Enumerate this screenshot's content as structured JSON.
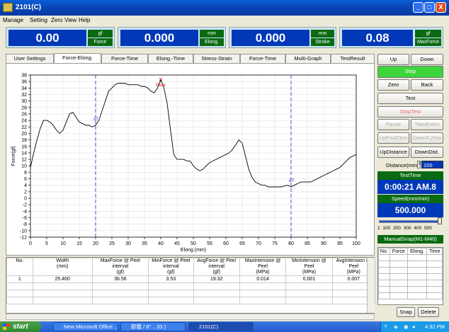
{
  "window": {
    "title": "2101(C)",
    "controls": [
      "_",
      "□",
      "X"
    ]
  },
  "menu": [
    "Manage",
    "Setting",
    "Zero",
    "View",
    "Help"
  ],
  "readouts": [
    {
      "value": "0.00",
      "unit": "gf",
      "name": "Force"
    },
    {
      "value": "0.000",
      "unit": "mm",
      "name": "Elong."
    },
    {
      "value": "0.000",
      "unit": "mm",
      "name": "Stroke"
    },
    {
      "value": "0.08",
      "unit": "gf",
      "name": "MaxForce"
    }
  ],
  "tabs": [
    "User Settings",
    "Force-Elong.",
    "Force-Time",
    "Elong.-Time",
    "Stress-Strain",
    "Force-Time",
    "Multi-Graph",
    "TestResult"
  ],
  "active_tab": 1,
  "chart_data": {
    "type": "line",
    "xlabel": "Elong.(mm)",
    "ylabel": "Force(gf)",
    "xlim": [
      0,
      100
    ],
    "ylim": [
      -12,
      38
    ],
    "xticks": [
      0,
      5,
      10,
      15,
      20,
      25,
      30,
      35,
      40,
      45,
      50,
      55,
      60,
      65,
      70,
      75,
      80,
      85,
      90,
      95,
      100
    ],
    "yticks": [
      -12,
      -10,
      -8,
      -6,
      -4,
      -2,
      0,
      2,
      4,
      6,
      8,
      10,
      12,
      14,
      16,
      18,
      20,
      22,
      24,
      26,
      28,
      30,
      32,
      34,
      36,
      38
    ],
    "grid": true,
    "markers": [
      {
        "label": "s7",
        "x": 20
      },
      {
        "label": "e7",
        "x": 80
      }
    ],
    "peak": {
      "label": "Peak",
      "x": 40,
      "y": 36.5
    },
    "x": [
      0,
      1,
      2,
      3,
      4,
      5,
      6,
      7,
      8,
      9,
      10,
      11,
      12,
      13,
      14,
      15,
      16,
      17,
      18,
      19,
      20,
      21,
      22,
      23,
      24,
      25,
      26,
      27,
      28,
      29,
      30,
      31,
      32,
      33,
      34,
      35,
      36,
      37,
      38,
      39,
      40,
      41,
      42,
      43,
      44,
      45,
      46,
      47,
      48,
      49,
      50,
      51,
      52,
      53,
      54,
      55,
      56,
      57,
      58,
      59,
      60,
      61,
      62,
      63,
      64,
      65,
      66,
      67,
      68,
      69,
      70,
      71,
      72,
      73,
      74,
      75,
      76,
      77,
      78,
      79,
      80,
      81,
      82,
      83,
      84,
      85,
      86,
      87,
      88,
      89,
      90,
      91,
      92,
      93,
      94,
      95,
      96,
      97,
      98,
      99,
      100
    ],
    "y": [
      9.5,
      14,
      18,
      21.5,
      24,
      24,
      23.5,
      22.5,
      21,
      20,
      21,
      23.5,
      26,
      26.5,
      25,
      23.5,
      23,
      22.5,
      22.5,
      22,
      22.5,
      24,
      27,
      30,
      33,
      34,
      35,
      35.5,
      35.5,
      35.5,
      35,
      35,
      35,
      35,
      34.5,
      34.5,
      34,
      33,
      32.5,
      34,
      36.5,
      34,
      29,
      21,
      13.5,
      12,
      12,
      12,
      11.5,
      11.5,
      10,
      9,
      8.5,
      9,
      10,
      11,
      11.5,
      12,
      12.5,
      13,
      13.5,
      14,
      15,
      16.5,
      18,
      17,
      13,
      9,
      6.5,
      5,
      4.5,
      4,
      4,
      3.5,
      3.5,
      3.5,
      3.5,
      3.5,
      3.8,
      4,
      3.5,
      4,
      4.5,
      5,
      5,
      5,
      5,
      5.5,
      6,
      6.5,
      7,
      7.5,
      8,
      8.5,
      9,
      9.5,
      10.5,
      11.5,
      12.5,
      13,
      13.5
    ]
  },
  "result_table": {
    "headers": [
      "No.",
      "Width\n(mm)",
      "MaxForce @ Peel interval\n(gf)",
      "MinForce @ Peel interval\n(gf)",
      "AvgForce @ Peel interval\n(gf)",
      "MaxIntension @ Peel\n(MPa)",
      "MinIntension @ Peel\n(MPa)",
      "AvgIntension @ Peel\n(MPa)"
    ],
    "rows": [
      [
        "1",
        "25.400",
        "36.56",
        "3.53",
        "19.32",
        "0.014",
        "0.001",
        "0.007"
      ]
    ]
  },
  "controls": {
    "up": "Up",
    "down": "Down",
    "stop": "Stop",
    "zero": "Zero",
    "back": "Back",
    "test": "Test",
    "stoptest": "StopTest",
    "pause": "Pause",
    "takeexten": "TakeExten",
    "upfindzero": "UpFindZero",
    "downfzero": "DownF.Zero",
    "updistance": "UpDistance",
    "downdist": "DownDist.",
    "distance_label": "Distance(mm)",
    "distance_value": "100",
    "testtime_label": "TestTime",
    "testtime_value": "0:00:21 AM.8",
    "speed_label": "Speed(mm/min)",
    "speed_value": "500.000",
    "speed_level": 1.0,
    "slider_ticks": "1 100 200 300 400 500",
    "manualsnap_label": "ManualSnap(M1-M40)",
    "snap_headers": [
      "No.",
      "Force",
      "Elong.",
      "Time"
    ],
    "snap": "Snap",
    "delete": "Delete"
  },
  "taskbar": {
    "start": "start",
    "tasks": [
      "New Microsoft Office ...",
      "卸载 / 8\"... (G:)",
      "2101(C)"
    ],
    "time": "4:32 PM"
  }
}
